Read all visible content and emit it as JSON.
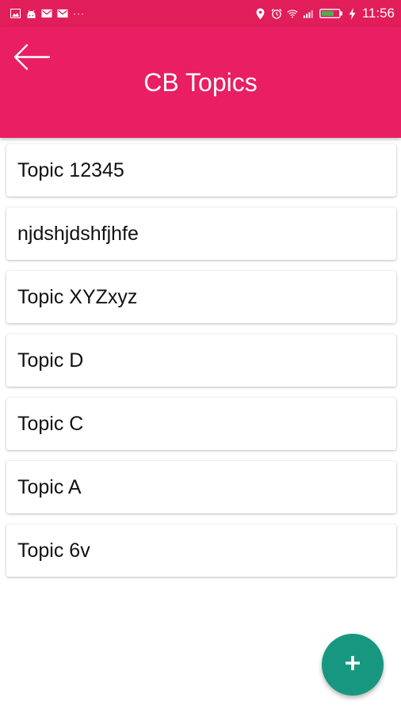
{
  "status_bar": {
    "time": "11:56",
    "left_icons": [
      "image-icon",
      "android-icon",
      "gmail-icon",
      "gmail-icon"
    ],
    "more_dots": "···",
    "right_icons": [
      "location-icon",
      "alarm-icon",
      "wifi-icon",
      "signal-icon",
      "battery-icon",
      "charging-icon"
    ]
  },
  "header": {
    "title": "CB Topics",
    "back_icon": "arrow-left-icon",
    "background": "#e91e63"
  },
  "topics": [
    {
      "label": "Topic 12345"
    },
    {
      "label": "njdshjdshfjhfe"
    },
    {
      "label": "Topic XYZxyz"
    },
    {
      "label": "Topic D"
    },
    {
      "label": "Topic C"
    },
    {
      "label": "Topic A"
    },
    {
      "label": "Topic 6v"
    }
  ],
  "fab": {
    "icon": "plus-icon",
    "color": "#17977f"
  }
}
